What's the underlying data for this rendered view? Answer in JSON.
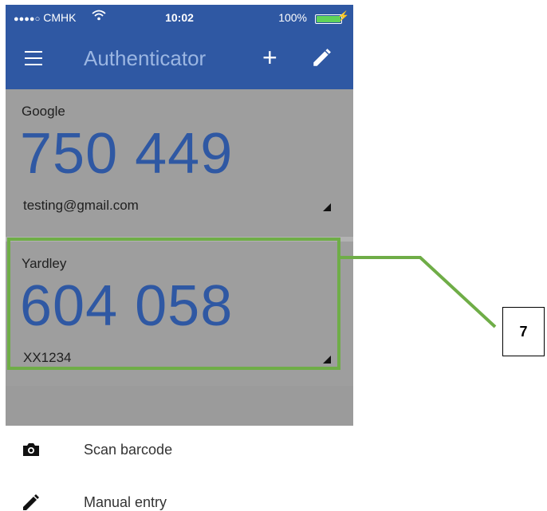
{
  "status_bar": {
    "carrier_dots": "●●●●○",
    "carrier": "CMHK",
    "time": "10:02",
    "battery": "100%"
  },
  "app_bar": {
    "title": "Authenticator",
    "icons": [
      "menu-icon",
      "plus-icon",
      "pencil-icon"
    ]
  },
  "accounts": [
    {
      "issuer": "Google",
      "code": "750 449",
      "user": "testing@gmail.com"
    },
    {
      "issuer": "Yardley",
      "code": "604 058",
      "user": "XX1234"
    }
  ],
  "bottom_sheet": {
    "items": [
      {
        "label": "Scan barcode",
        "icon": "camera-icon"
      },
      {
        "label": "Manual entry",
        "icon": "pencil-icon"
      }
    ]
  },
  "annotation": {
    "label": "7",
    "color": "#6fad47"
  },
  "colors": {
    "app_bar": "#2f58a3",
    "code": "#2f58a3",
    "overlay": "#9e9e9e"
  }
}
